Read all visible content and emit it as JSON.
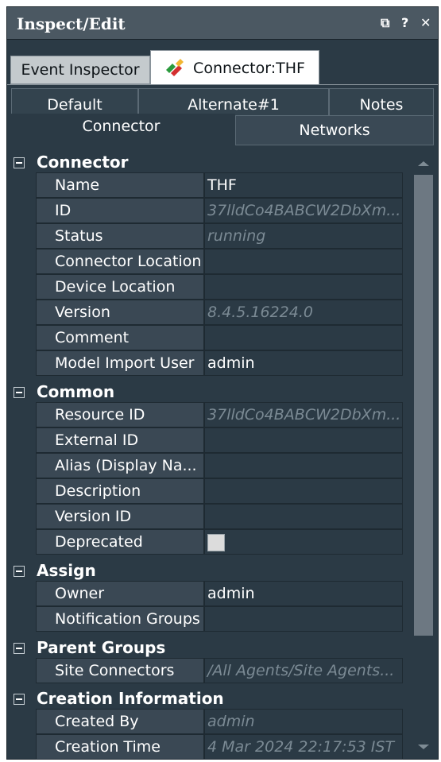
{
  "window": {
    "title": "Inspect/Edit",
    "controls": [
      "⧉",
      "?",
      "✕"
    ]
  },
  "tabs": [
    {
      "label": "Event Inspector"
    },
    {
      "label": "Connector:THF"
    }
  ],
  "subtabs_row1": [
    "Default",
    "Alternate#1",
    "Notes"
  ],
  "subtabs_row2": [
    "Connector",
    "Networks"
  ],
  "sections": {
    "connector": {
      "title": "Connector",
      "rows": [
        {
          "label": "Name",
          "value": "THF"
        },
        {
          "label": "ID",
          "value": "37lldCo4BABCW2DbXm..."
        },
        {
          "label": "Status",
          "value": "running"
        },
        {
          "label": "Connector Location",
          "value": ""
        },
        {
          "label": "Device Location",
          "value": ""
        },
        {
          "label": "Version",
          "value": "8.4.5.16224.0"
        },
        {
          "label": "Comment",
          "value": ""
        },
        {
          "label": "Model Import User",
          "value": "admin"
        }
      ]
    },
    "common": {
      "title": "Common",
      "rows": [
        {
          "label": "Resource ID",
          "value": "37lldCo4BABCW2DbXm..."
        },
        {
          "label": "External ID",
          "value": ""
        },
        {
          "label": "Alias (Display Na...",
          "value": ""
        },
        {
          "label": "Description",
          "value": ""
        },
        {
          "label": "Version ID",
          "value": ""
        },
        {
          "label": "Deprecated",
          "value": ""
        }
      ]
    },
    "assign": {
      "title": "Assign",
      "rows": [
        {
          "label": "Owner",
          "value": "admin"
        },
        {
          "label": "Notification Groups",
          "value": ""
        }
      ]
    },
    "parent_groups": {
      "title": "Parent Groups",
      "rows": [
        {
          "label": "Site Connectors",
          "value": "/All Agents/Site Agents..."
        }
      ]
    },
    "creation": {
      "title": "Creation Information",
      "rows": [
        {
          "label": "Created By",
          "value": "admin"
        },
        {
          "label": "Creation Time",
          "value": "4 Mar 2024 22:17:53 IST"
        }
      ]
    }
  },
  "deprecated_checked": false,
  "colors": {
    "panel": "#2b3a45",
    "titlebar": "#4b5862",
    "label_cell": "#3a4854",
    "muted_text": "#7b8a94"
  }
}
